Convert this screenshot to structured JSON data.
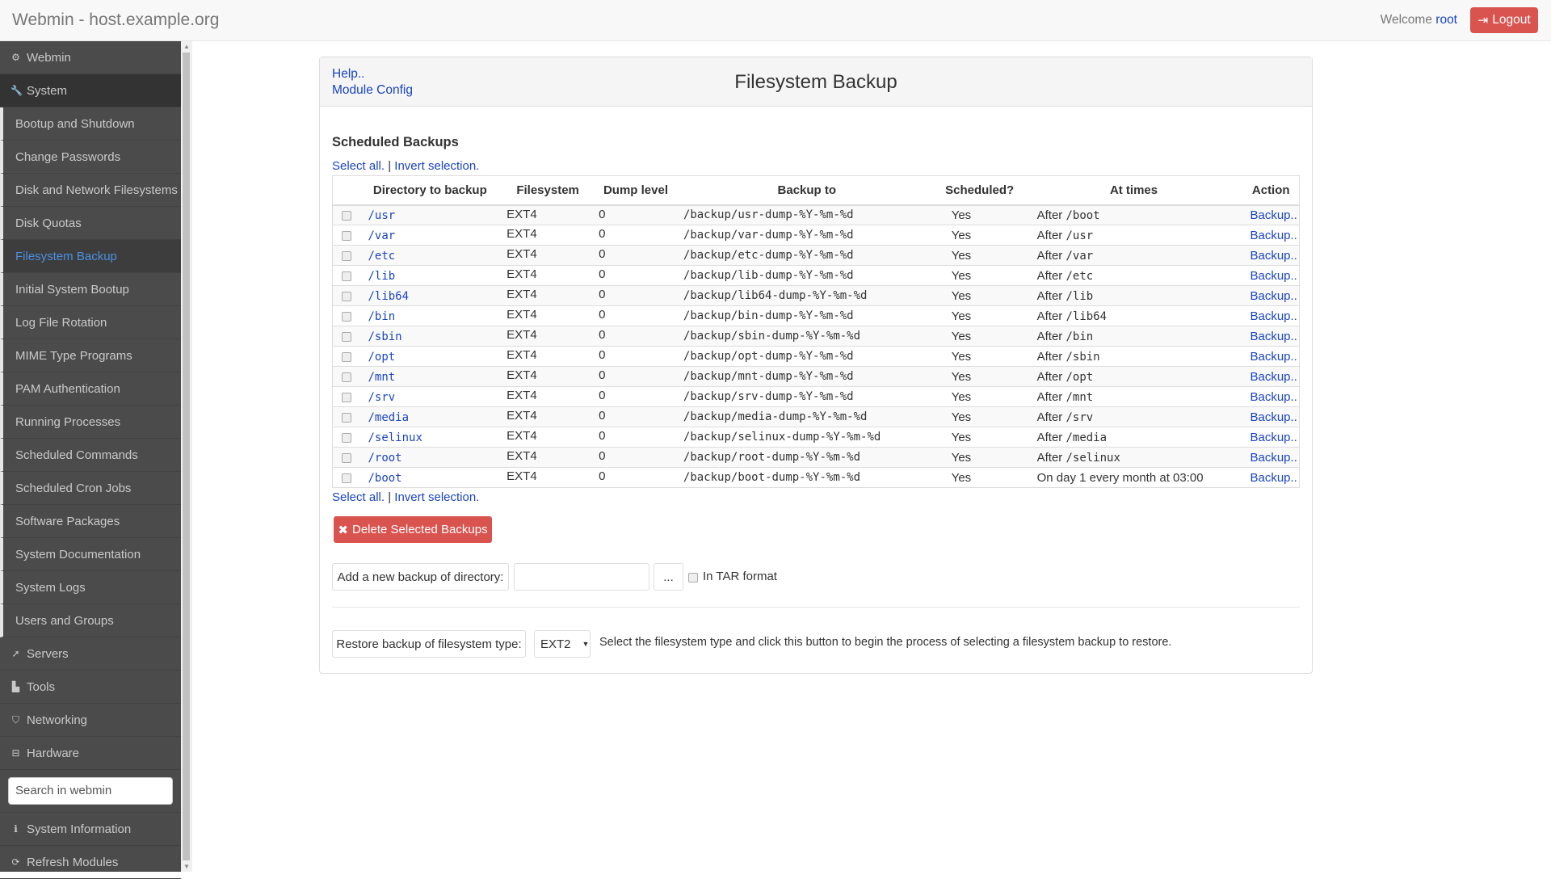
{
  "header": {
    "title": "Webmin - host.example.org",
    "welcome": "Welcome",
    "user": "root",
    "logout": "Logout"
  },
  "sidebar": {
    "top": [
      {
        "label": "Webmin",
        "icon": "gear-icon",
        "glyph": "⚙"
      },
      {
        "label": "System",
        "icon": "wrench-icon",
        "glyph": "🔧"
      }
    ],
    "items": [
      "Bootup and Shutdown",
      "Change Passwords",
      "Disk and Network Filesystems",
      "Disk Quotas",
      "Filesystem Backup",
      "Initial System Bootup",
      "Log File Rotation",
      "MIME Type Programs",
      "PAM Authentication",
      "Running Processes",
      "Scheduled Commands",
      "Scheduled Cron Jobs",
      "Software Packages",
      "System Documentation",
      "System Logs",
      "Users and Groups"
    ],
    "active": "Filesystem Backup",
    "categories": [
      {
        "label": "Servers",
        "icon": "rocket-icon",
        "glyph": "➚"
      },
      {
        "label": "Tools",
        "icon": "file-icon",
        "glyph": "▙"
      },
      {
        "label": "Networking",
        "icon": "shield-icon",
        "glyph": "⛉"
      },
      {
        "label": "Hardware",
        "icon": "hdd-icon",
        "glyph": "⊟"
      }
    ],
    "search_placeholder": "Search in webmin",
    "bottom": [
      {
        "label": "System Information",
        "icon": "info-icon",
        "glyph": "ℹ"
      },
      {
        "label": "Refresh Modules",
        "icon": "refresh-icon",
        "glyph": "⟳"
      }
    ]
  },
  "panel": {
    "help": "Help..",
    "module_config": "Module Config",
    "title": "Filesystem Backup"
  },
  "scheduled": {
    "heading": "Scheduled Backups",
    "select_all": "Select all.",
    "sep": "|",
    "invert": "Invert selection.",
    "columns": [
      "Directory to backup",
      "Filesystem",
      "Dump level",
      "Backup to",
      "Scheduled?",
      "At times",
      "Action"
    ],
    "rows": [
      {
        "dir": "/usr",
        "fs": "EXT4",
        "level": "0",
        "to": "/backup/usr-dump-%Y-%m-%d",
        "sched": "Yes",
        "after": "After",
        "times": "/boot",
        "action": "Backup.."
      },
      {
        "dir": "/var",
        "fs": "EXT4",
        "level": "0",
        "to": "/backup/var-dump-%Y-%m-%d",
        "sched": "Yes",
        "after": "After",
        "times": "/usr",
        "action": "Backup.."
      },
      {
        "dir": "/etc",
        "fs": "EXT4",
        "level": "0",
        "to": "/backup/etc-dump-%Y-%m-%d",
        "sched": "Yes",
        "after": "After",
        "times": "/var",
        "action": "Backup.."
      },
      {
        "dir": "/lib",
        "fs": "EXT4",
        "level": "0",
        "to": "/backup/lib-dump-%Y-%m-%d",
        "sched": "Yes",
        "after": "After",
        "times": "/etc",
        "action": "Backup.."
      },
      {
        "dir": "/lib64",
        "fs": "EXT4",
        "level": "0",
        "to": "/backup/lib64-dump-%Y-%m-%d",
        "sched": "Yes",
        "after": "After",
        "times": "/lib",
        "action": "Backup.."
      },
      {
        "dir": "/bin",
        "fs": "EXT4",
        "level": "0",
        "to": "/backup/bin-dump-%Y-%m-%d",
        "sched": "Yes",
        "after": "After",
        "times": "/lib64",
        "action": "Backup.."
      },
      {
        "dir": "/sbin",
        "fs": "EXT4",
        "level": "0",
        "to": "/backup/sbin-dump-%Y-%m-%d",
        "sched": "Yes",
        "after": "After",
        "times": "/bin",
        "action": "Backup.."
      },
      {
        "dir": "/opt",
        "fs": "EXT4",
        "level": "0",
        "to": "/backup/opt-dump-%Y-%m-%d",
        "sched": "Yes",
        "after": "After",
        "times": "/sbin",
        "action": "Backup.."
      },
      {
        "dir": "/mnt",
        "fs": "EXT4",
        "level": "0",
        "to": "/backup/mnt-dump-%Y-%m-%d",
        "sched": "Yes",
        "after": "After",
        "times": "/opt",
        "action": "Backup.."
      },
      {
        "dir": "/srv",
        "fs": "EXT4",
        "level": "0",
        "to": "/backup/srv-dump-%Y-%m-%d",
        "sched": "Yes",
        "after": "After",
        "times": "/mnt",
        "action": "Backup.."
      },
      {
        "dir": "/media",
        "fs": "EXT4",
        "level": "0",
        "to": "/backup/media-dump-%Y-%m-%d",
        "sched": "Yes",
        "after": "After",
        "times": "/srv",
        "action": "Backup.."
      },
      {
        "dir": "/selinux",
        "fs": "EXT4",
        "level": "0",
        "to": "/backup/selinux-dump-%Y-%m-%d",
        "sched": "Yes",
        "after": "After",
        "times": "/media",
        "action": "Backup.."
      },
      {
        "dir": "/root",
        "fs": "EXT4",
        "level": "0",
        "to": "/backup/root-dump-%Y-%m-%d",
        "sched": "Yes",
        "after": "After",
        "times": "/selinux",
        "action": "Backup.."
      },
      {
        "dir": "/boot",
        "fs": "EXT4",
        "level": "0",
        "to": "/backup/boot-dump-%Y-%m-%d",
        "sched": "Yes",
        "after": "",
        "times": "On day 1 every month at 03:00",
        "action": "Backup.."
      }
    ]
  },
  "actions": {
    "delete": "Delete Selected Backups",
    "add_label": "Add a new backup of directory:",
    "add_value": "",
    "browse": "...",
    "tar_label": "In TAR format",
    "restore_label": "Restore backup of filesystem type:",
    "restore_type": "EXT2",
    "restore_help": "Select the filesystem type and click this button to begin the process of selecting a filesystem backup to restore."
  },
  "colors": {
    "accent": "#1a45c0",
    "danger": "#d9534f",
    "sidebar": "#4b4b4b",
    "active_item": "#4a90e2"
  }
}
